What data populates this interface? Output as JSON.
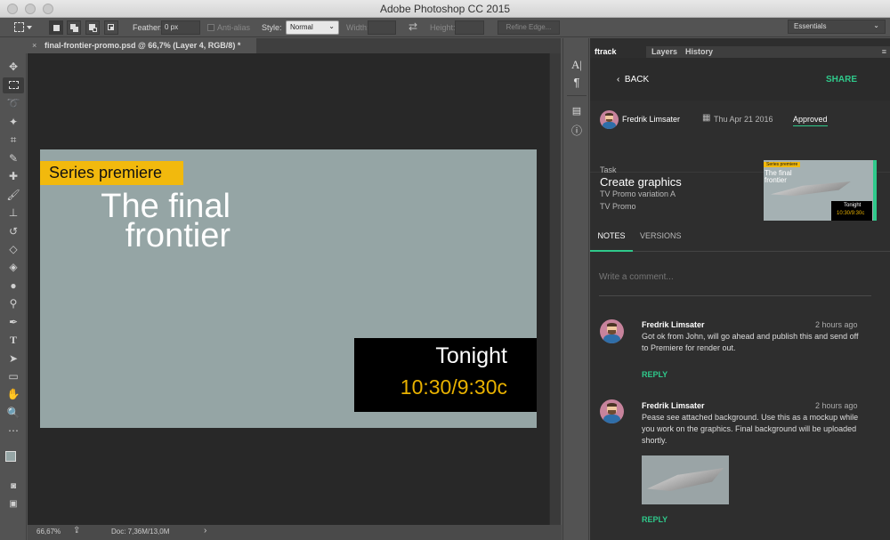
{
  "window": {
    "title": "Adobe Photoshop CC 2015"
  },
  "options": {
    "feather_label": "Feather:",
    "feather_value": "0 px",
    "antialias_label": "Anti-alias",
    "style_label": "Style:",
    "style_value": "Normal",
    "width_label": "Width:",
    "height_label": "Height:",
    "refine_label": "Refine Edge...",
    "workspace": "Essentials"
  },
  "document": {
    "tab_label": "final-frontier-promo.psd @ 66,7% (Layer 4, RGB/8) *",
    "close_glyph": "×"
  },
  "artwork": {
    "series": "Series premiere",
    "title_line1": "The final",
    "title_line2": "frontier",
    "tonight": "Tonight",
    "time": "10:30/9:30c",
    "accent": "#f2b90d",
    "bg": "#95a5a5"
  },
  "status": {
    "zoom": "66,67%",
    "doc": "Doc: 7,36M/13,0M",
    "arrow": "›"
  },
  "panel": {
    "tabs": [
      "ftrack",
      "Layers",
      "History"
    ],
    "back": "BACK",
    "share": "SHARE",
    "assignee": "Fredrik Limsater",
    "date": "Thu Apr 21 2016",
    "status": "Approved",
    "task_label": "Task",
    "task_name": "Create graphics",
    "task_parent": "TV Promo variation A",
    "task_project": "TV Promo",
    "thumb": {
      "series": "Series premiere",
      "title": "The final frontier",
      "tonight": "Tonight",
      "time": "10:30/9:30c"
    },
    "notes_tab": "NOTES",
    "versions_tab": "VERSIONS",
    "comment_placeholder": "Write a comment...",
    "accent": "#2fc98b",
    "notes": [
      {
        "author": "Fredrik Limsater",
        "time": "2 hours ago",
        "text": "Got ok from John, will go ahead and publish this and send off to Premiere for render out.",
        "reply": "REPLY"
      },
      {
        "author": "Fredrik Limsater",
        "time": "2 hours ago",
        "text": "Pease see attached background. Use this as a mockup while you work on the graphics. Final background will be uploaded shortly.",
        "reply": "REPLY"
      }
    ]
  }
}
